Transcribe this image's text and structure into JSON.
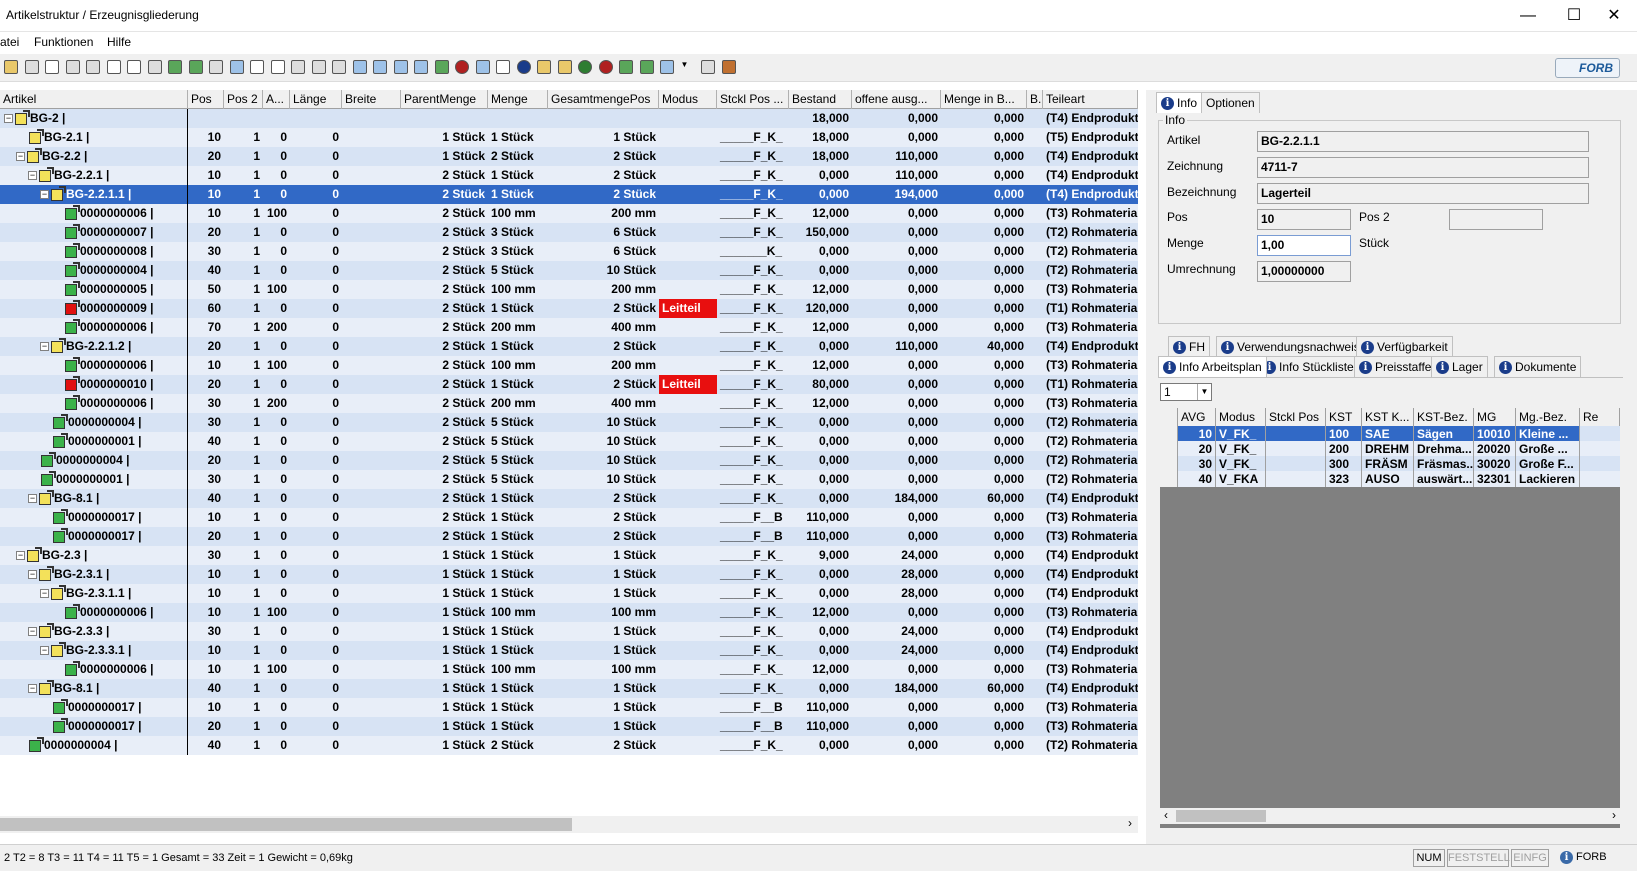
{
  "window": {
    "title": "Artikelstruktur / Erzeugnisgliederung",
    "controls": {
      "minimize": "—",
      "maximize": "☐",
      "close": "✕"
    }
  },
  "menu": {
    "items": [
      "atei",
      "Funktionen",
      "Hilfe"
    ]
  },
  "toolbar": {
    "icons": [
      "open-folder-icon",
      "save-icon",
      "print-preview-icon",
      "binoculars-icon",
      "search-replace-icon",
      "checklist-icon",
      "copy-icon",
      "grid-icon",
      "tree-icon",
      "tree-multi-icon",
      "tree-expand-icon",
      "tree-collapse-icon",
      "blank-page-icon",
      "page-icon",
      "branch-icon",
      "arrow-right-icon",
      "floppy-icon",
      "stack-icon",
      "stack2-icon",
      "stack3-icon",
      "card-icon",
      "table-green-icon",
      "table-red-icon",
      "window-icon",
      "doc-icon",
      "info-icon",
      "folder-open-icon",
      "yellow-icon",
      "green-circle-icon",
      "red-circle-icon",
      "gear-icon",
      "refresh-icon",
      "image-icon",
      "dropdown-icon",
      "printer-icon",
      "book-icon"
    ],
    "logo": "FORB"
  },
  "grid": {
    "columns": [
      "Artikel",
      "Pos",
      "Pos 2",
      "A...",
      "Länge",
      "Breite",
      "ParentMenge",
      "Menge",
      "GesamtmengePos",
      "Modus",
      "Stckl Pos ...",
      "Bestand",
      "offene ausg...",
      "Menge in B...",
      "B.",
      "Teileart"
    ],
    "rows": [
      {
        "level": 0,
        "exp": "−",
        "icon": "y",
        "art": "BG-2 |",
        "pos": "",
        "pos2": "",
        "a": "",
        "laenge": "",
        "breite": "",
        "parent": "",
        "menge": "",
        "gesamt": "",
        "modus": "",
        "stckl": "",
        "bestand": "18,000",
        "offen": "0,000",
        "mengeb": "0,000",
        "b": "",
        "teileart": "(T4) Endprodukt"
      },
      {
        "level": 1,
        "exp": "",
        "icon": "y",
        "art": "BG-2.1 |",
        "pos": "10",
        "pos2": "1",
        "a": "0",
        "laenge": "0",
        "breite": "",
        "parent": "1 Stück",
        "menge": "1 Stück",
        "gesamt": "1 Stück",
        "modus": "",
        "stckl": "_____F_K_",
        "bestand": "18,000",
        "offen": "0,000",
        "mengeb": "0,000",
        "b": "",
        "teileart": "(T5) Endprodukt"
      },
      {
        "level": 1,
        "exp": "−",
        "icon": "y",
        "art": "BG-2.2 |",
        "pos": "20",
        "pos2": "1",
        "a": "0",
        "laenge": "0",
        "breite": "",
        "parent": "1 Stück",
        "menge": "2 Stück",
        "gesamt": "2 Stück",
        "modus": "",
        "stckl": "_____F_K_",
        "bestand": "18,000",
        "offen": "110,000",
        "mengeb": "0,000",
        "b": "",
        "teileart": "(T4) Endprodukt"
      },
      {
        "level": 2,
        "exp": "−",
        "icon": "y",
        "art": "BG-2.2.1 |",
        "pos": "10",
        "pos2": "1",
        "a": "0",
        "laenge": "0",
        "breite": "",
        "parent": "2 Stück",
        "menge": "1 Stück",
        "gesamt": "2 Stück",
        "modus": "",
        "stckl": "_____F_K_",
        "bestand": "0,000",
        "offen": "110,000",
        "mengeb": "0,000",
        "b": "",
        "teileart": "(T4) Endprodukt"
      },
      {
        "level": 3,
        "exp": "−",
        "icon": "y",
        "art": "BG-2.2.1.1 |",
        "pos": "10",
        "pos2": "1",
        "a": "0",
        "laenge": "0",
        "breite": "",
        "parent": "2 Stück",
        "menge": "1 Stück",
        "gesamt": "2 Stück",
        "modus": "",
        "stckl": "_____F_K_",
        "bestand": "0,000",
        "offen": "194,000",
        "mengeb": "0,000",
        "b": "",
        "teileart": "(T4) Endprodukt",
        "sel": true
      },
      {
        "level": 4,
        "exp": "",
        "icon": "g",
        "art": "0000000006 |",
        "pos": "10",
        "pos2": "1",
        "a": "100",
        "laenge": "0",
        "breite": "",
        "parent": "2 Stück",
        "menge": "100 mm",
        "gesamt": "200 mm",
        "modus": "",
        "stckl": "_____F_K_",
        "bestand": "12,000",
        "offen": "0,000",
        "mengeb": "0,000",
        "b": "",
        "teileart": "(T3) Rohmateria"
      },
      {
        "level": 4,
        "exp": "",
        "icon": "g",
        "art": "0000000007 |",
        "pos": "20",
        "pos2": "1",
        "a": "0",
        "laenge": "0",
        "breite": "",
        "parent": "2 Stück",
        "menge": "3 Stück",
        "gesamt": "6 Stück",
        "modus": "",
        "stckl": "_____F_K_",
        "bestand": "150,000",
        "offen": "0,000",
        "mengeb": "0,000",
        "b": "",
        "teileart": "(T2) Rohmateria"
      },
      {
        "level": 4,
        "exp": "",
        "icon": "g",
        "art": "0000000008 |",
        "pos": "30",
        "pos2": "1",
        "a": "0",
        "laenge": "0",
        "breite": "",
        "parent": "2 Stück",
        "menge": "3 Stück",
        "gesamt": "6 Stück",
        "modus": "",
        "stckl": "_______K_",
        "bestand": "0,000",
        "offen": "0,000",
        "mengeb": "0,000",
        "b": "",
        "teileart": "(T2) Rohmateria"
      },
      {
        "level": 4,
        "exp": "",
        "icon": "g",
        "art": "0000000004 |",
        "pos": "40",
        "pos2": "1",
        "a": "0",
        "laenge": "0",
        "breite": "",
        "parent": "2 Stück",
        "menge": "5 Stück",
        "gesamt": "10 Stück",
        "modus": "",
        "stckl": "_____F_K_",
        "bestand": "0,000",
        "offen": "0,000",
        "mengeb": "0,000",
        "b": "",
        "teileart": "(T2) Rohmateria"
      },
      {
        "level": 4,
        "exp": "",
        "icon": "g",
        "art": "0000000005 |",
        "pos": "50",
        "pos2": "1",
        "a": "100",
        "laenge": "0",
        "breite": "",
        "parent": "2 Stück",
        "menge": "100 mm",
        "gesamt": "200 mm",
        "modus": "",
        "stckl": "_____F_K_",
        "bestand": "12,000",
        "offen": "0,000",
        "mengeb": "0,000",
        "b": "",
        "teileart": "(T3) Rohmateria"
      },
      {
        "level": 4,
        "exp": "",
        "icon": "r",
        "art": "0000000009 |",
        "pos": "60",
        "pos2": "1",
        "a": "0",
        "laenge": "0",
        "breite": "",
        "parent": "2 Stück",
        "menge": "1 Stück",
        "gesamt": "2 Stück",
        "modus": "Leitteil",
        "stckl": "_____F_K_",
        "bestand": "120,000",
        "offen": "0,000",
        "mengeb": "0,000",
        "b": "",
        "teileart": "(T1) Rohmateria"
      },
      {
        "level": 4,
        "exp": "",
        "icon": "g",
        "art": "0000000006 |",
        "pos": "70",
        "pos2": "1",
        "a": "200",
        "laenge": "0",
        "breite": "",
        "parent": "2 Stück",
        "menge": "200 mm",
        "gesamt": "400 mm",
        "modus": "",
        "stckl": "_____F_K_",
        "bestand": "12,000",
        "offen": "0,000",
        "mengeb": "0,000",
        "b": "",
        "teileart": "(T3) Rohmateria"
      },
      {
        "level": 3,
        "exp": "−",
        "icon": "y",
        "art": "BG-2.2.1.2 |",
        "pos": "20",
        "pos2": "1",
        "a": "0",
        "laenge": "0",
        "breite": "",
        "parent": "2 Stück",
        "menge": "1 Stück",
        "gesamt": "2 Stück",
        "modus": "",
        "stckl": "_____F_K_",
        "bestand": "0,000",
        "offen": "110,000",
        "mengeb": "40,000",
        "b": "",
        "teileart": "(T4) Endprodukt"
      },
      {
        "level": 4,
        "exp": "",
        "icon": "g",
        "art": "0000000006 |",
        "pos": "10",
        "pos2": "1",
        "a": "100",
        "laenge": "0",
        "breite": "",
        "parent": "2 Stück",
        "menge": "100 mm",
        "gesamt": "200 mm",
        "modus": "",
        "stckl": "_____F_K_",
        "bestand": "12,000",
        "offen": "0,000",
        "mengeb": "0,000",
        "b": "",
        "teileart": "(T3) Rohmateria"
      },
      {
        "level": 4,
        "exp": "",
        "icon": "r",
        "art": "0000000010 |",
        "pos": "20",
        "pos2": "1",
        "a": "0",
        "laenge": "0",
        "breite": "",
        "parent": "2 Stück",
        "menge": "1 Stück",
        "gesamt": "2 Stück",
        "modus": "Leitteil",
        "stckl": "_____F_K_",
        "bestand": "80,000",
        "offen": "0,000",
        "mengeb": "0,000",
        "b": "",
        "teileart": "(T1) Rohmateria"
      },
      {
        "level": 4,
        "exp": "",
        "icon": "g",
        "art": "0000000006 |",
        "pos": "30",
        "pos2": "1",
        "a": "200",
        "laenge": "0",
        "breite": "",
        "parent": "2 Stück",
        "menge": "200 mm",
        "gesamt": "400 mm",
        "modus": "",
        "stckl": "_____F_K_",
        "bestand": "12,000",
        "offen": "0,000",
        "mengeb": "0,000",
        "b": "",
        "teileart": "(T3) Rohmateria"
      },
      {
        "level": 3,
        "exp": "",
        "icon": "g",
        "art": "0000000004 |",
        "pos": "30",
        "pos2": "1",
        "a": "0",
        "laenge": "0",
        "breite": "",
        "parent": "2 Stück",
        "menge": "5 Stück",
        "gesamt": "10 Stück",
        "modus": "",
        "stckl": "_____F_K_",
        "bestand": "0,000",
        "offen": "0,000",
        "mengeb": "0,000",
        "b": "",
        "teileart": "(T2) Rohmateria"
      },
      {
        "level": 3,
        "exp": "",
        "icon": "g",
        "art": "0000000001 |",
        "pos": "40",
        "pos2": "1",
        "a": "0",
        "laenge": "0",
        "breite": "",
        "parent": "2 Stück",
        "menge": "5 Stück",
        "gesamt": "10 Stück",
        "modus": "",
        "stckl": "_____F_K_",
        "bestand": "0,000",
        "offen": "0,000",
        "mengeb": "0,000",
        "b": "",
        "teileart": "(T2) Rohmateria"
      },
      {
        "level": 2,
        "exp": "",
        "icon": "g",
        "art": "0000000004 |",
        "pos": "20",
        "pos2": "1",
        "a": "0",
        "laenge": "0",
        "breite": "",
        "parent": "2 Stück",
        "menge": "5 Stück",
        "gesamt": "10 Stück",
        "modus": "",
        "stckl": "_____F_K_",
        "bestand": "0,000",
        "offen": "0,000",
        "mengeb": "0,000",
        "b": "",
        "teileart": "(T2) Rohmateria"
      },
      {
        "level": 2,
        "exp": "",
        "icon": "g",
        "art": "0000000001 |",
        "pos": "30",
        "pos2": "1",
        "a": "0",
        "laenge": "0",
        "breite": "",
        "parent": "2 Stück",
        "menge": "5 Stück",
        "gesamt": "10 Stück",
        "modus": "",
        "stckl": "_____F_K_",
        "bestand": "0,000",
        "offen": "0,000",
        "mengeb": "0,000",
        "b": "",
        "teileart": "(T2) Rohmateria"
      },
      {
        "level": 2,
        "exp": "−",
        "icon": "y",
        "art": "BG-8.1 |",
        "pos": "40",
        "pos2": "1",
        "a": "0",
        "laenge": "0",
        "breite": "",
        "parent": "2 Stück",
        "menge": "1 Stück",
        "gesamt": "2 Stück",
        "modus": "",
        "stckl": "_____F_K_",
        "bestand": "0,000",
        "offen": "184,000",
        "mengeb": "60,000",
        "b": "",
        "teileart": "(T4) Endprodukt"
      },
      {
        "level": 3,
        "exp": "",
        "icon": "g",
        "art": "0000000017 |",
        "pos": "10",
        "pos2": "1",
        "a": "0",
        "laenge": "0",
        "breite": "",
        "parent": "2 Stück",
        "menge": "1 Stück",
        "gesamt": "2 Stück",
        "modus": "",
        "stckl": "_____F__B",
        "bestand": "110,000",
        "offen": "0,000",
        "mengeb": "0,000",
        "b": "",
        "teileart": "(T3) Rohmateria"
      },
      {
        "level": 3,
        "exp": "",
        "icon": "g",
        "art": "0000000017 |",
        "pos": "20",
        "pos2": "1",
        "a": "0",
        "laenge": "0",
        "breite": "",
        "parent": "2 Stück",
        "menge": "1 Stück",
        "gesamt": "2 Stück",
        "modus": "",
        "stckl": "_____F__B",
        "bestand": "110,000",
        "offen": "0,000",
        "mengeb": "0,000",
        "b": "",
        "teileart": "(T3) Rohmateria"
      },
      {
        "level": 1,
        "exp": "−",
        "icon": "y",
        "art": "BG-2.3 |",
        "pos": "30",
        "pos2": "1",
        "a": "0",
        "laenge": "0",
        "breite": "",
        "parent": "1 Stück",
        "menge": "1 Stück",
        "gesamt": "1 Stück",
        "modus": "",
        "stckl": "_____F_K_",
        "bestand": "9,000",
        "offen": "24,000",
        "mengeb": "0,000",
        "b": "",
        "teileart": "(T4) Endprodukt"
      },
      {
        "level": 2,
        "exp": "−",
        "icon": "y",
        "art": "BG-2.3.1 |",
        "pos": "10",
        "pos2": "1",
        "a": "0",
        "laenge": "0",
        "breite": "",
        "parent": "1 Stück",
        "menge": "1 Stück",
        "gesamt": "1 Stück",
        "modus": "",
        "stckl": "_____F_K_",
        "bestand": "0,000",
        "offen": "28,000",
        "mengeb": "0,000",
        "b": "",
        "teileart": "(T4) Endprodukt"
      },
      {
        "level": 3,
        "exp": "−",
        "icon": "y",
        "art": "BG-2.3.1.1 |",
        "pos": "10",
        "pos2": "1",
        "a": "0",
        "laenge": "0",
        "breite": "",
        "parent": "1 Stück",
        "menge": "1 Stück",
        "gesamt": "1 Stück",
        "modus": "",
        "stckl": "_____F_K_",
        "bestand": "0,000",
        "offen": "28,000",
        "mengeb": "0,000",
        "b": "",
        "teileart": "(T4) Endprodukt"
      },
      {
        "level": 4,
        "exp": "",
        "icon": "g",
        "art": "0000000006 |",
        "pos": "10",
        "pos2": "1",
        "a": "100",
        "laenge": "0",
        "breite": "",
        "parent": "1 Stück",
        "menge": "100 mm",
        "gesamt": "100 mm",
        "modus": "",
        "stckl": "_____F_K_",
        "bestand": "12,000",
        "offen": "0,000",
        "mengeb": "0,000",
        "b": "",
        "teileart": "(T3) Rohmateria"
      },
      {
        "level": 2,
        "exp": "−",
        "icon": "y",
        "art": "BG-2.3.3 |",
        "pos": "30",
        "pos2": "1",
        "a": "0",
        "laenge": "0",
        "breite": "",
        "parent": "1 Stück",
        "menge": "1 Stück",
        "gesamt": "1 Stück",
        "modus": "",
        "stckl": "_____F_K_",
        "bestand": "0,000",
        "offen": "24,000",
        "mengeb": "0,000",
        "b": "",
        "teileart": "(T4) Endprodukt"
      },
      {
        "level": 3,
        "exp": "−",
        "icon": "y",
        "art": "BG-2.3.3.1 |",
        "pos": "10",
        "pos2": "1",
        "a": "0",
        "laenge": "0",
        "breite": "",
        "parent": "1 Stück",
        "menge": "1 Stück",
        "gesamt": "1 Stück",
        "modus": "",
        "stckl": "_____F_K_",
        "bestand": "0,000",
        "offen": "24,000",
        "mengeb": "0,000",
        "b": "",
        "teileart": "(T4) Endprodukt"
      },
      {
        "level": 4,
        "exp": "",
        "icon": "g",
        "art": "0000000006 |",
        "pos": "10",
        "pos2": "1",
        "a": "100",
        "laenge": "0",
        "breite": "",
        "parent": "1 Stück",
        "menge": "100 mm",
        "gesamt": "100 mm",
        "modus": "",
        "stckl": "_____F_K_",
        "bestand": "12,000",
        "offen": "0,000",
        "mengeb": "0,000",
        "b": "",
        "teileart": "(T3) Rohmateria"
      },
      {
        "level": 2,
        "exp": "−",
        "icon": "y",
        "art": "BG-8.1 |",
        "pos": "40",
        "pos2": "1",
        "a": "0",
        "laenge": "0",
        "breite": "",
        "parent": "1 Stück",
        "menge": "1 Stück",
        "gesamt": "1 Stück",
        "modus": "",
        "stckl": "_____F_K_",
        "bestand": "0,000",
        "offen": "184,000",
        "mengeb": "60,000",
        "b": "",
        "teileart": "(T4) Endprodukt"
      },
      {
        "level": 3,
        "exp": "",
        "icon": "g",
        "art": "0000000017 |",
        "pos": "10",
        "pos2": "1",
        "a": "0",
        "laenge": "0",
        "breite": "",
        "parent": "1 Stück",
        "menge": "1 Stück",
        "gesamt": "1 Stück",
        "modus": "",
        "stckl": "_____F__B",
        "bestand": "110,000",
        "offen": "0,000",
        "mengeb": "0,000",
        "b": "",
        "teileart": "(T3) Rohmateria"
      },
      {
        "level": 3,
        "exp": "",
        "icon": "g",
        "art": "0000000017 |",
        "pos": "20",
        "pos2": "1",
        "a": "0",
        "laenge": "0",
        "breite": "",
        "parent": "1 Stück",
        "menge": "1 Stück",
        "gesamt": "1 Stück",
        "modus": "",
        "stckl": "_____F__B",
        "bestand": "110,000",
        "offen": "0,000",
        "mengeb": "0,000",
        "b": "",
        "teileart": "(T3) Rohmateria"
      },
      {
        "level": 1,
        "exp": "",
        "icon": "g",
        "art": "0000000004 |",
        "pos": "40",
        "pos2": "1",
        "a": "0",
        "laenge": "0",
        "breite": "",
        "parent": "1 Stück",
        "menge": "2 Stück",
        "gesamt": "2 Stück",
        "modus": "",
        "stckl": "_____F_K_",
        "bestand": "0,000",
        "offen": "0,000",
        "mengeb": "0,000",
        "b": "",
        "teileart": "(T2) Rohmateria"
      }
    ]
  },
  "status": {
    "text": "2 T2 = 8 T3 = 11 T4 = 11 T5 = 1 Gesamt = 33 Zeit = 1 Gewicht = 0,69kg",
    "num": "NUM",
    "feststell": "FESTSTELL",
    "einfg": "EINFG",
    "user": "FORB"
  },
  "right": {
    "tabs_top": [
      "Info",
      "Optionen"
    ],
    "info_group": "Info",
    "fields": {
      "artikel_label": "Artikel",
      "artikel": "BG-2.2.1.1",
      "zeichnung_label": "Zeichnung",
      "zeichnung": "4711-7",
      "bezeichnung_label": "Bezeichnung",
      "bezeichnung": "Lagerteil",
      "pos_label": "Pos",
      "pos": "10",
      "pos2_label": "Pos 2",
      "pos2": "",
      "menge_label": "Menge",
      "menge": "1,00",
      "menge_unit": "Stück",
      "umrechnung_label": "Umrechnung",
      "umrechnung": "1,00000000"
    },
    "tabs_row1": [
      "FH",
      "Verwendungsnachweis",
      "Verfügbarkeit"
    ],
    "tabs_row2": [
      "Info Arbeitsplan",
      "Info Stückliste",
      "Preisstaffel",
      "Lager",
      "Dokumente"
    ],
    "select_value": "1",
    "sub_columns": [
      "AVG",
      "Modus",
      "Stckl Pos",
      "KST",
      "KST K...",
      "KST-Bez.",
      "MG",
      "Mg.-Bez.",
      "Re"
    ],
    "sub_rows": [
      [
        "10",
        "V_FK_",
        "",
        "100",
        "SAE",
        "Sägen",
        "10010",
        "Kleine ..."
      ],
      [
        "20",
        "V_FK_",
        "",
        "200",
        "DREHM",
        "Drehma...",
        "20020",
        "Große ..."
      ],
      [
        "30",
        "V_FK_",
        "",
        "300",
        "FRÄSM",
        "Fräsmas...",
        "30020",
        "Große F..."
      ],
      [
        "40",
        "V_FKA",
        "",
        "323",
        "AUSO",
        "auswärt...",
        "32301",
        "Lackieren"
      ]
    ]
  },
  "colors": {
    "selection": "#3169c6",
    "leitteil": "#e80f0f",
    "row_odd": "#d7e3f4",
    "row_even": "#e8eef8",
    "empty_area": "#808080"
  }
}
